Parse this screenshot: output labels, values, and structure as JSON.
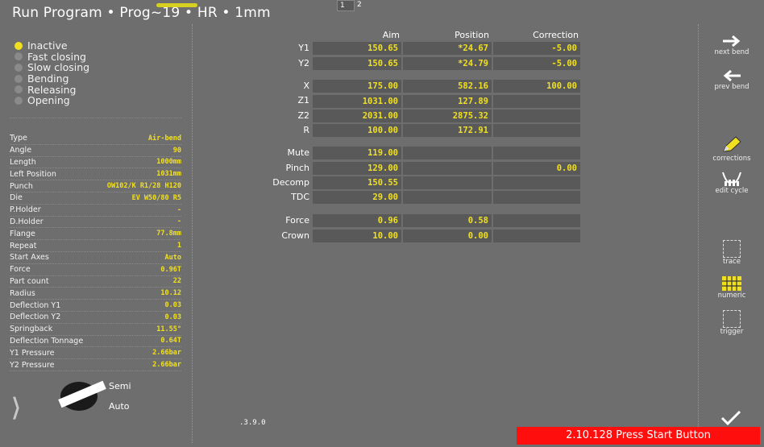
{
  "header": {
    "title": "Run Program  •  Prog~19  •  HR  •  1mm",
    "page_tabs": [
      "1",
      "2"
    ]
  },
  "status_list": [
    {
      "label": "Inactive",
      "active": true
    },
    {
      "label": "Fast closing",
      "active": false
    },
    {
      "label": "Slow closing",
      "active": false
    },
    {
      "label": "Bending",
      "active": false
    },
    {
      "label": "Releasing",
      "active": false
    },
    {
      "label": "Opening",
      "active": false
    }
  ],
  "params": [
    {
      "label": "Type",
      "value": "Air-bend"
    },
    {
      "label": "Angle",
      "value": "90"
    },
    {
      "label": "Length",
      "value": "1000mm"
    },
    {
      "label": "Left Position",
      "value": "1031mm"
    },
    {
      "label": "Punch",
      "value": "OW102/K R1/28 H120"
    },
    {
      "label": "Die",
      "value": "EV W50/80 R5"
    },
    {
      "label": "P.Holder",
      "value": "-"
    },
    {
      "label": "D.Holder",
      "value": "-"
    },
    {
      "label": "Flange",
      "value": "77.8mm"
    },
    {
      "label": "Repeat",
      "value": "1"
    },
    {
      "label": "Start Axes",
      "value": "Auto"
    },
    {
      "label": "Force",
      "value": "0.96T"
    },
    {
      "label": "Part count",
      "value": "22"
    },
    {
      "label": "Radius",
      "value": "10.12"
    },
    {
      "label": "Deflection Y1",
      "value": "0.03"
    },
    {
      "label": "Deflection Y2",
      "value": "0.03"
    },
    {
      "label": "Springback",
      "value": "11.55°"
    },
    {
      "label": "Deflection Tonnage",
      "value": "0.64T"
    },
    {
      "label": "Y1 Pressure",
      "value": "2.66bar"
    },
    {
      "label": "Y2 Pressure",
      "value": "2.66bar"
    }
  ],
  "mode": {
    "semi": "Semi",
    "auto": "Auto"
  },
  "table": {
    "headers": {
      "aim": "Aim",
      "position": "Position",
      "correction": "Correction"
    },
    "rows": [
      {
        "label": "Y1",
        "aim": "150.65",
        "position": "*24.67",
        "correction": "-5.00"
      },
      {
        "label": "Y2",
        "aim": "150.65",
        "position": "*24.79",
        "correction": "-5.00"
      },
      {
        "label": "X",
        "aim": "175.00",
        "position": "582.16",
        "correction": "100.00"
      },
      {
        "label": "Z1",
        "aim": "1031.00",
        "position": "127.89",
        "correction": ""
      },
      {
        "label": "Z2",
        "aim": "2031.00",
        "position": "2875.32",
        "correction": ""
      },
      {
        "label": "R",
        "aim": "100.00",
        "position": "172.91",
        "correction": ""
      },
      {
        "label": "Mute",
        "aim": "119.00",
        "position": "",
        "correction": ""
      },
      {
        "label": "Pinch",
        "aim": "129.00",
        "position": "",
        "correction": "0.00"
      },
      {
        "label": "Decomp",
        "aim": "150.55",
        "position": "",
        "correction": ""
      },
      {
        "label": "TDC",
        "aim": "29.00",
        "position": "",
        "correction": ""
      },
      {
        "label": "Force",
        "aim": "0.96",
        "position": "0.58",
        "correction": ""
      },
      {
        "label": "Crown",
        "aim": "10.00",
        "position": "0.00",
        "correction": ""
      }
    ]
  },
  "toolbar": {
    "next_bend": "next bend",
    "prev_bend": "prev bend",
    "corrections": "corrections",
    "edit_cycle": "edit cycle",
    "trace": "trace",
    "numeric": "numeric",
    "trigger": "trigger"
  },
  "version": ".3.9.0",
  "status_bar": "2.10.128 Press Start Button",
  "colors": {
    "value": "#f0e020",
    "background": "#6e6e6e",
    "cell": "#595959",
    "alert": "#ff0e0e"
  }
}
